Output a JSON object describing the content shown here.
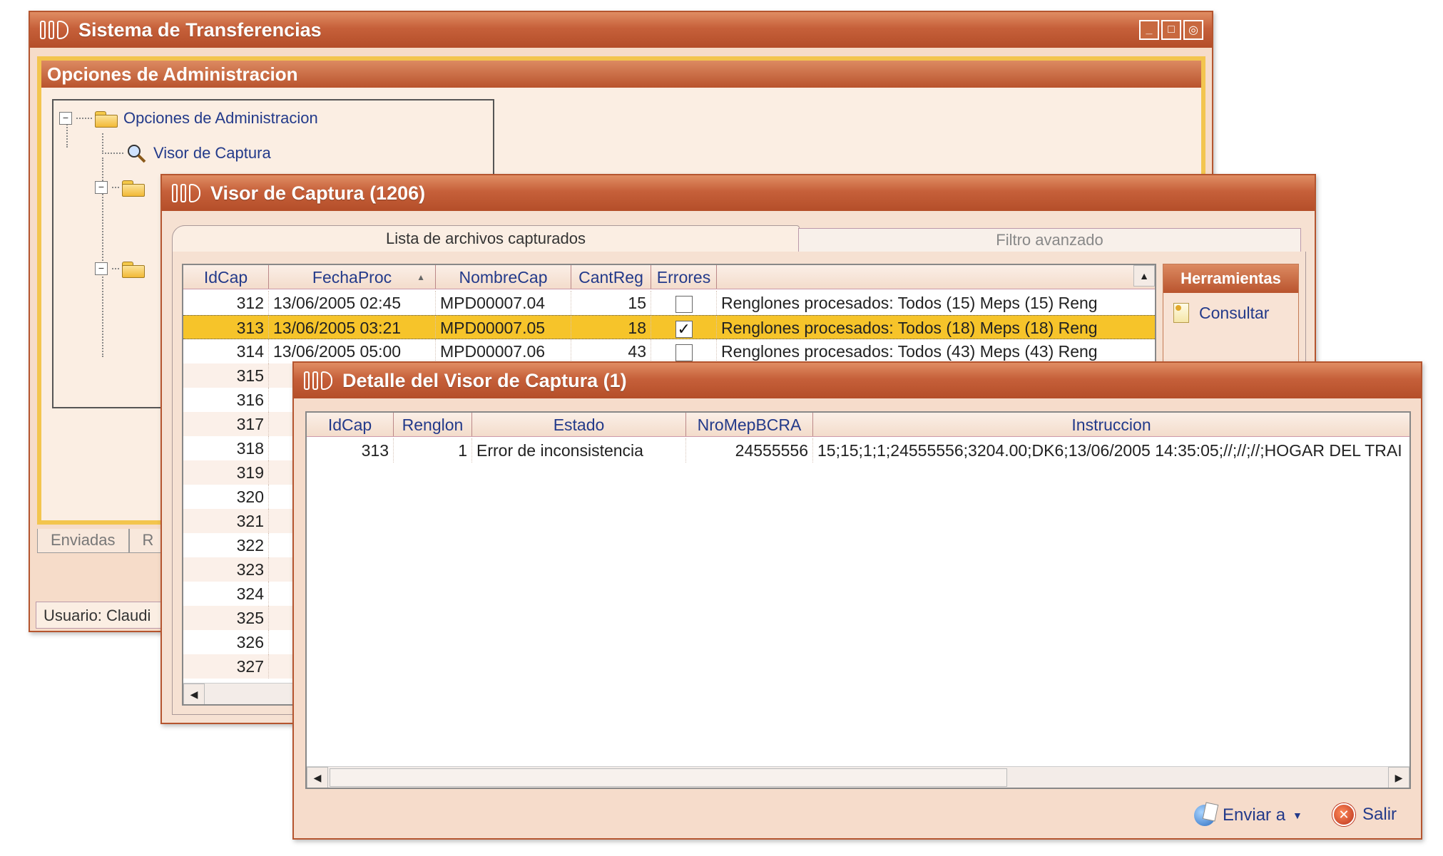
{
  "main_window": {
    "title": "Sistema de Transferencias",
    "group_title": "Opciones de Administracion",
    "tree": {
      "root": "Opciones de Administracion",
      "child": "Visor de Captura"
    },
    "bottom_tabs": [
      "Enviadas",
      "R"
    ],
    "status": "Usuario: Claudi"
  },
  "visor_window": {
    "title": "Visor de Captura (1206)",
    "tabs": [
      "Lista de archivos capturados",
      "Filtro avanzado"
    ],
    "columns": [
      "IdCap",
      "FechaProc",
      "NombreCap",
      "CantReg",
      "Errores"
    ],
    "rows": [
      {
        "id": "312",
        "fecha": "13/06/2005 02:45",
        "nombre": "MPD00007.04",
        "cant": "15",
        "errores": false,
        "desc": "Renglones procesados: Todos (15)  Meps (15)  Reng"
      },
      {
        "id": "313",
        "fecha": "13/06/2005 03:21",
        "nombre": "MPD00007.05",
        "cant": "18",
        "errores": true,
        "desc": "Renglones procesados: Todos (18)  Meps (18)  Reng"
      },
      {
        "id": "314",
        "fecha": "13/06/2005 05:00",
        "nombre": "MPD00007.06",
        "cant": "43",
        "errores": false,
        "desc": "Renglones procesados: Todos (43)  Meps (43)  Reng"
      },
      {
        "id": "315"
      },
      {
        "id": "316"
      },
      {
        "id": "317"
      },
      {
        "id": "318"
      },
      {
        "id": "319"
      },
      {
        "id": "320"
      },
      {
        "id": "321"
      },
      {
        "id": "322"
      },
      {
        "id": "323"
      },
      {
        "id": "324"
      },
      {
        "id": "325"
      },
      {
        "id": "326"
      },
      {
        "id": "327"
      }
    ],
    "tools": {
      "title": "Herramientas",
      "item": "Consultar"
    }
  },
  "detalle_window": {
    "title": "Detalle del Visor de Captura (1)",
    "columns": [
      "IdCap",
      "Renglon",
      "Estado",
      "NroMepBCRA",
      "Instruccion"
    ],
    "rows": [
      {
        "id": "313",
        "renglon": "1",
        "estado": "Error de inconsistencia",
        "nromep": "24555556",
        "instruccion": "15;15;1;1;24555556;3204.00;DK6;13/06/2005  14:35:05;//;//;//;HOGAR  DEL  TRAI"
      }
    ],
    "buttons": {
      "send": "Enviar a",
      "exit": "Salir"
    }
  },
  "colors": {
    "title_bar": "#b9542e",
    "accent_frame": "#f3c54e",
    "selected_row": "#f6c42a",
    "link_text": "#233a8a"
  }
}
